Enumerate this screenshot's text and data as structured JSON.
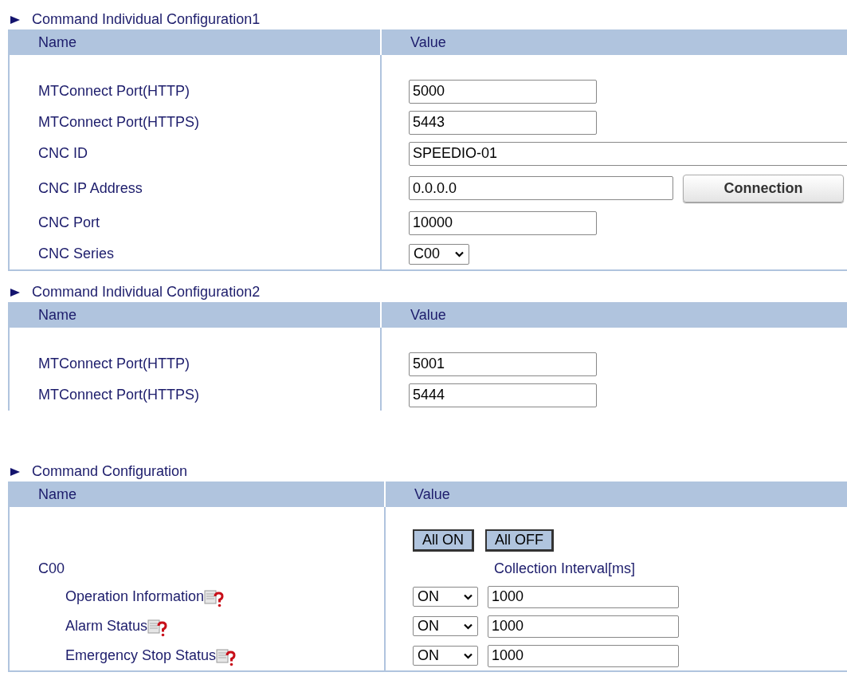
{
  "sections": [
    {
      "title": "Command Individual Configuration1",
      "columns": [
        "Name",
        "Value"
      ],
      "rows": [
        {
          "label": "MTConnect Port(HTTP)",
          "kind": "port",
          "value": "5000"
        },
        {
          "label": "MTConnect Port(HTTPS)",
          "kind": "port",
          "value": "5443"
        },
        {
          "label": "CNC ID",
          "kind": "id",
          "value": "SPEEDIO-01"
        },
        {
          "label": "CNC IP Address",
          "kind": "address",
          "value": "0.0.0.0",
          "button": "Connection"
        },
        {
          "label": "CNC Port",
          "kind": "port",
          "value": "10000"
        },
        {
          "label": "CNC Series",
          "kind": "select",
          "value": "C00"
        }
      ]
    },
    {
      "title": "Command Individual Configuration2",
      "columns": [
        "Name",
        "Value"
      ],
      "rows": [
        {
          "label": "MTConnect Port(HTTP)",
          "kind": "port",
          "value": "5001"
        },
        {
          "label": "MTConnect Port(HTTPS)",
          "kind": "port",
          "value": "5444"
        }
      ]
    }
  ],
  "command": {
    "title": "Command Configuration",
    "columns": [
      "Name",
      "Value"
    ],
    "buttons": [
      "All ON",
      "All OFF"
    ],
    "group": "C00",
    "interval_heading": "Collection Interval[ms]",
    "items": [
      {
        "label": "Operation Information",
        "state": "ON",
        "interval": "1000"
      },
      {
        "label": "Alarm Status",
        "state": "ON",
        "interval": "1000"
      },
      {
        "label": "Emergency Stop Status",
        "state": "ON",
        "interval": "1000"
      }
    ]
  }
}
